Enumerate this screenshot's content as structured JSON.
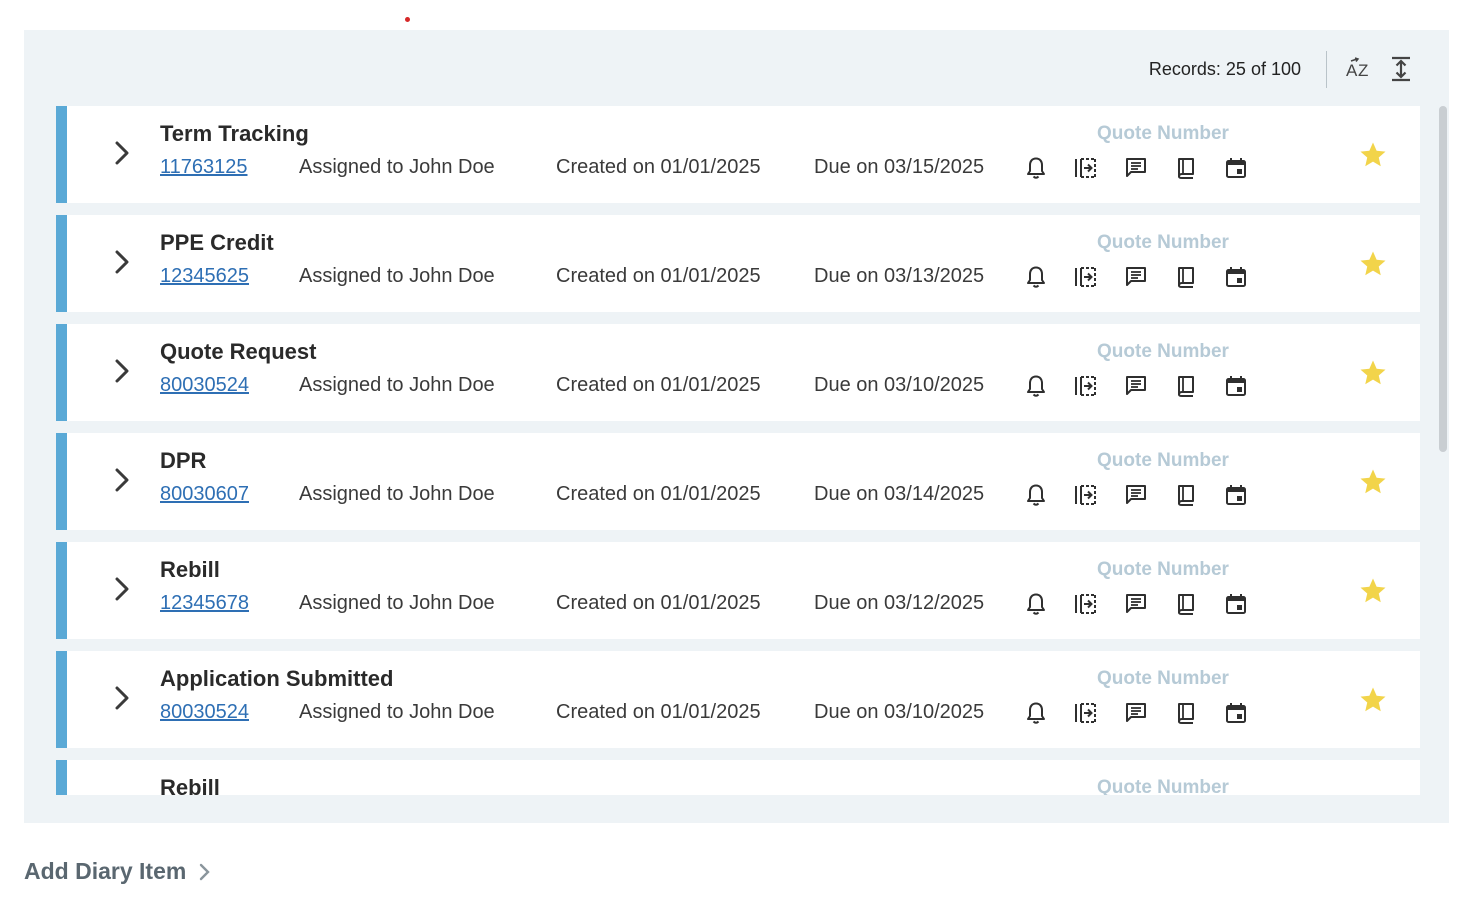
{
  "header": {
    "records_text": "Records: 25 of 100",
    "sort_icon": "sort-az-icon",
    "expand_icon": "expand-vertical-icon"
  },
  "colors": {
    "accent": "#5aa9d6",
    "star": "#f2d44a",
    "quote_number": "#b6cad6",
    "link": "#2e6fb4"
  },
  "rows": [
    {
      "title": "Term Tracking",
      "number": "11763125",
      "assigned": "Assigned to John Doe",
      "created": "Created on 01/01/2025",
      "due": "Due on 03/15/2025",
      "quote_label": "Quote Number"
    },
    {
      "title": "PPE Credit",
      "number": "12345625",
      "assigned": "Assigned to John Doe",
      "created": "Created on 01/01/2025",
      "due": "Due on 03/13/2025",
      "quote_label": "Quote Number"
    },
    {
      "title": "Quote Request",
      "number": "80030524",
      "assigned": "Assigned to John Doe",
      "created": "Created on 01/01/2025",
      "due": "Due on 03/10/2025",
      "quote_label": "Quote Number"
    },
    {
      "title": "DPR",
      "number": "80030607",
      "assigned": "Assigned to John Doe",
      "created": "Created on 01/01/2025",
      "due": "Due on 03/14/2025",
      "quote_label": "Quote Number"
    },
    {
      "title": "Rebill",
      "number": "12345678",
      "assigned": "Assigned to John Doe",
      "created": "Created on 01/01/2025",
      "due": "Due on 03/12/2025",
      "quote_label": "Quote Number"
    },
    {
      "title": "Application Submitted",
      "number": "80030524",
      "assigned": "Assigned to John Doe",
      "created": "Created on 01/01/2025",
      "due": "Due on 03/10/2025",
      "quote_label": "Quote Number"
    },
    {
      "title": "Rebill",
      "number": "",
      "assigned": "",
      "created": "",
      "due": "",
      "quote_label": "Quote Number"
    }
  ],
  "row_icons": [
    "bell-icon",
    "move-to-icon",
    "comment-icon",
    "book-icon",
    "calendar-icon"
  ],
  "footer": {
    "add_diary_label": "Add Diary Item"
  }
}
